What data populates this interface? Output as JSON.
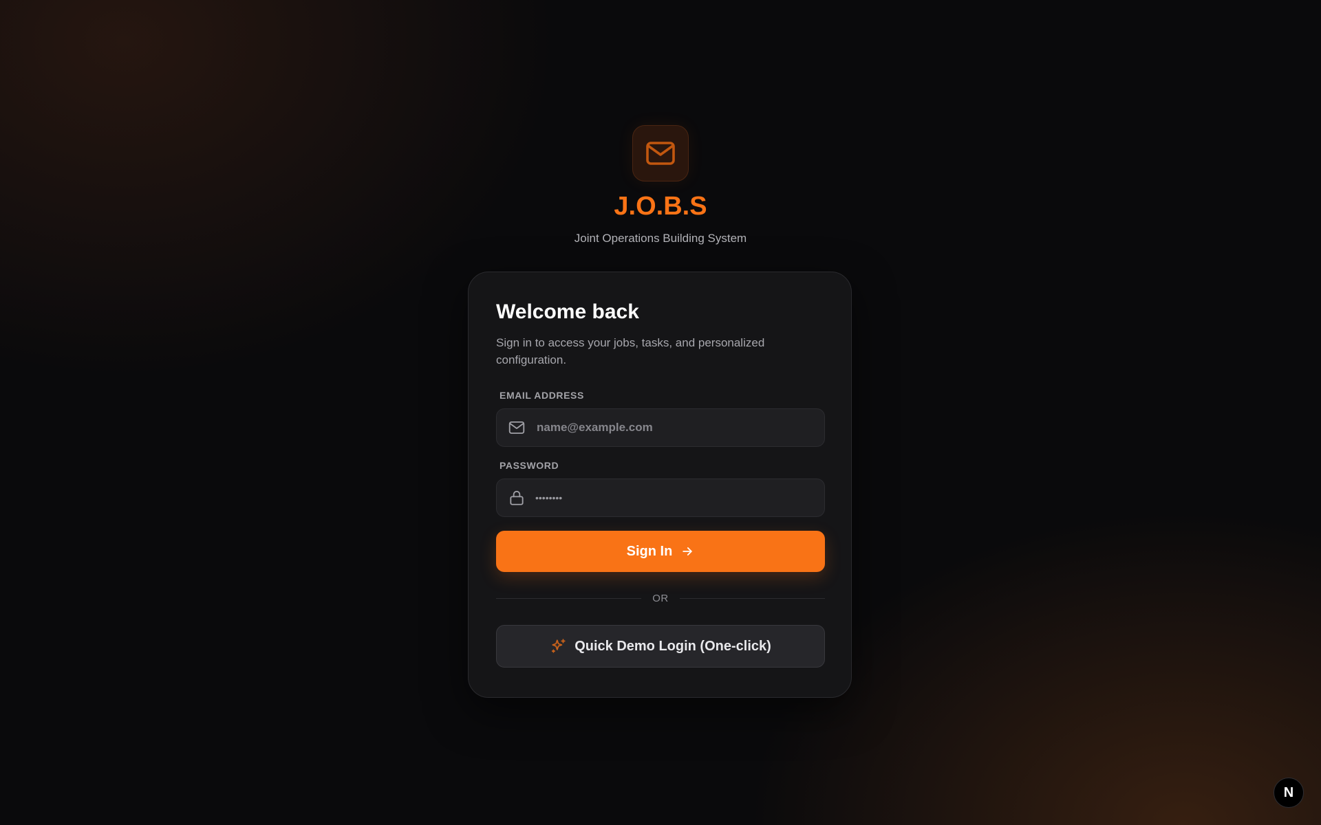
{
  "brand": {
    "title": "J.O.B.S",
    "subtitle": "Joint Operations Building System",
    "logo_icon": "mail-icon",
    "accent_color": "#f97316"
  },
  "login_card": {
    "title": "Welcome back",
    "description": "Sign in to access your jobs, tasks, and personalized configuration.",
    "email": {
      "label": "EMAIL ADDRESS",
      "placeholder": "name@example.com",
      "value": "",
      "icon": "mail-icon"
    },
    "password": {
      "label": "PASSWORD",
      "masked_value": "••••••••",
      "icon": "lock-icon"
    },
    "sign_in_button": {
      "label": "Sign In",
      "icon": "arrow-right-icon"
    },
    "divider_text": "OR",
    "demo_button": {
      "label": "Quick Demo Login (One-click)",
      "icon": "sparkles-icon"
    }
  },
  "dev_badge": {
    "label": "N",
    "icon": "nextjs-icon"
  }
}
